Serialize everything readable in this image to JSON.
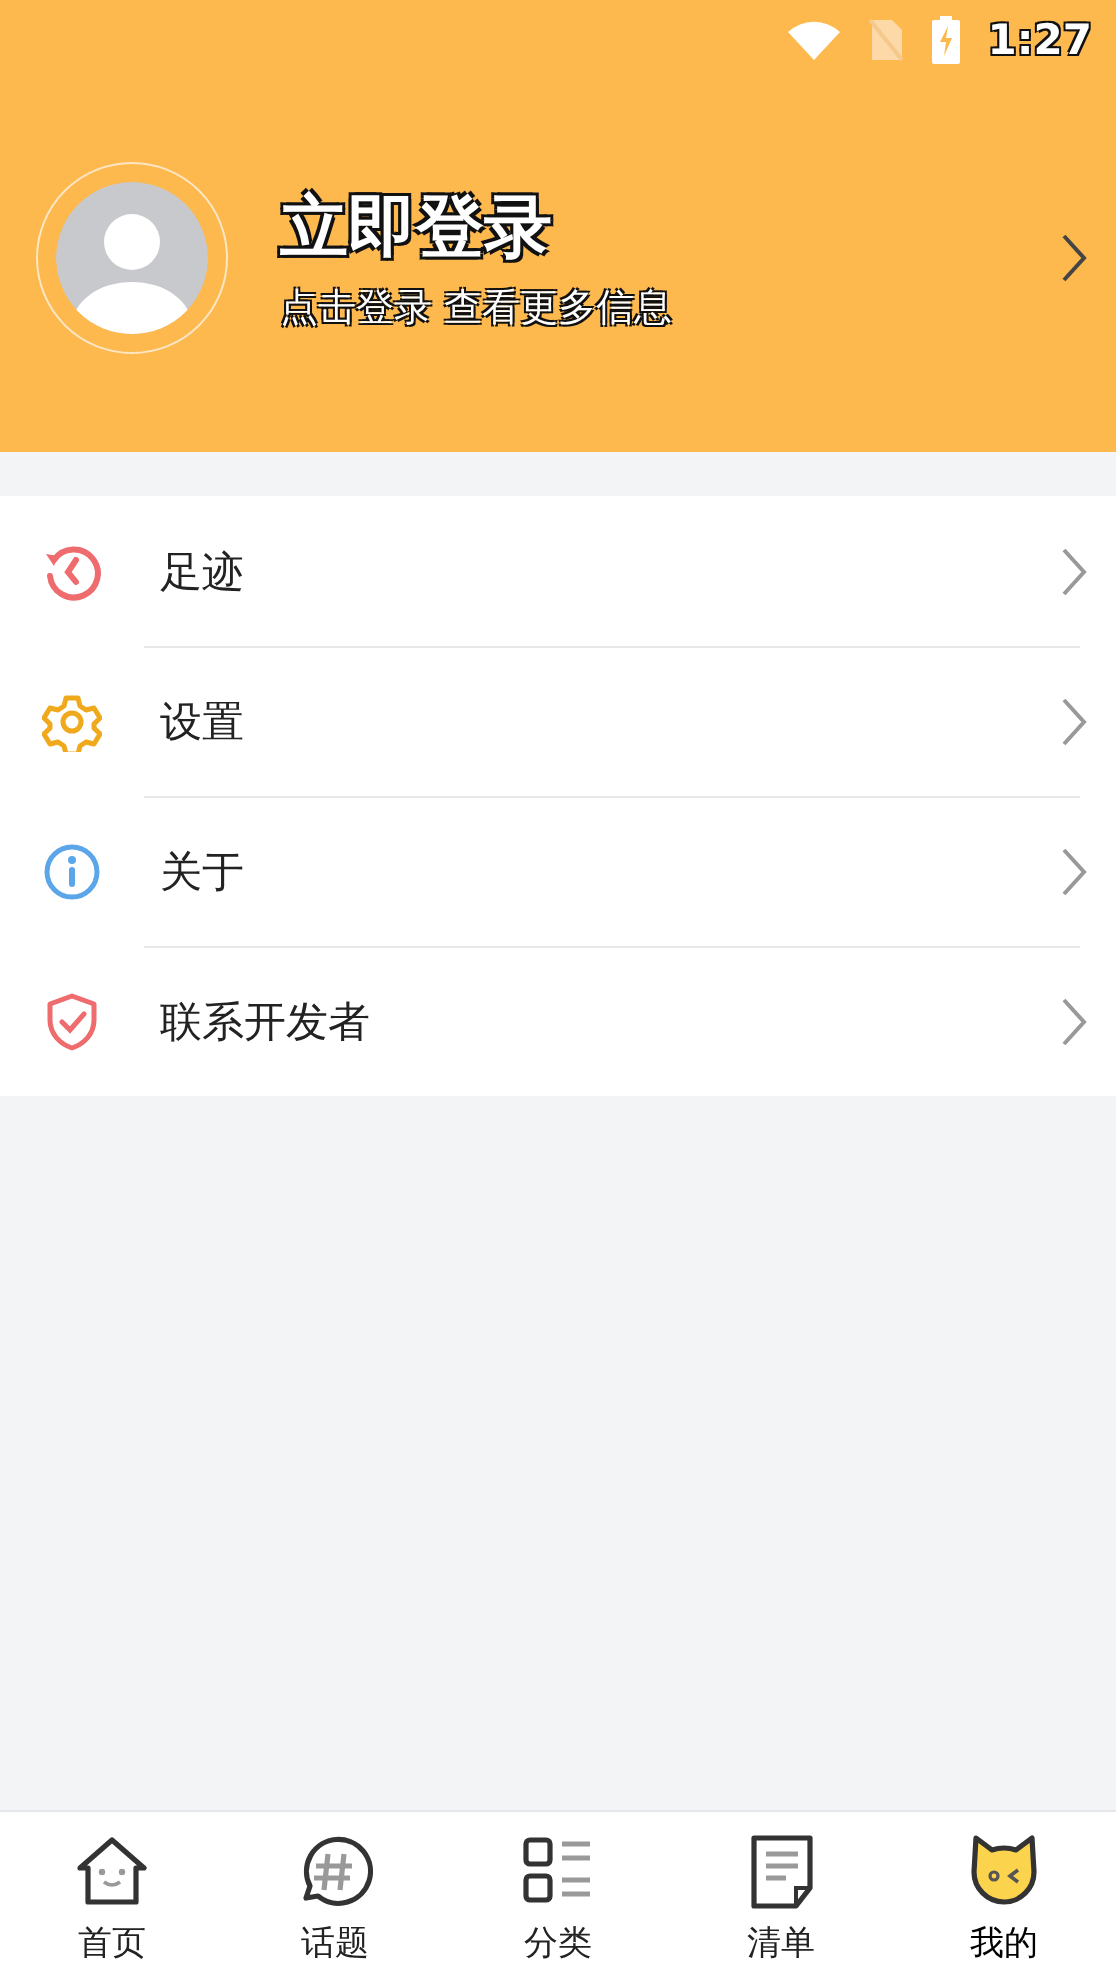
{
  "status_bar": {
    "time": "1:27"
  },
  "profile": {
    "title": "立即登录",
    "subtitle": "点击登录 查看更多信息"
  },
  "menu": [
    {
      "kind": "history",
      "label": "足迹",
      "color": "#ee6b6e"
    },
    {
      "kind": "settings",
      "label": "设置",
      "color": "#f0a81c"
    },
    {
      "kind": "about",
      "label": "关于",
      "color": "#5aa6e8"
    },
    {
      "kind": "contact",
      "label": "联系开发者",
      "color": "#ee6b6e"
    }
  ],
  "tabs": [
    {
      "kind": "home",
      "label": "首页",
      "selected": false
    },
    {
      "kind": "topic",
      "label": "话题",
      "selected": false
    },
    {
      "kind": "category",
      "label": "分类",
      "selected": false
    },
    {
      "kind": "list",
      "label": "清单",
      "selected": false
    },
    {
      "kind": "mine",
      "label": "我的",
      "selected": true
    }
  ]
}
